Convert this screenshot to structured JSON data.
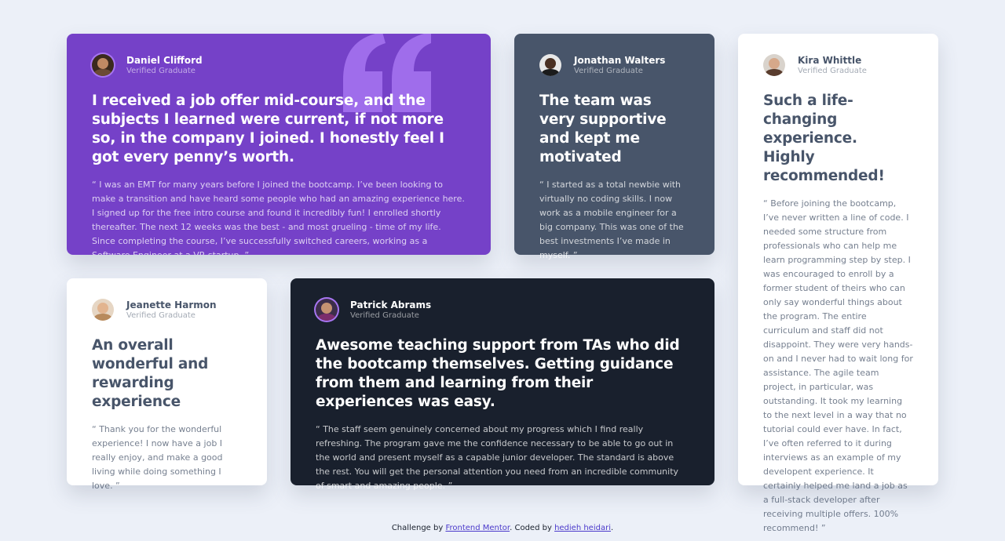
{
  "testimonials": [
    {
      "name": "Daniel Clifford",
      "role": "Verified Graduate",
      "headline": "I received a job offer mid-course, and the subjects I learned were current, if not more so, in the company I joined. I honestly feel I got every penny’s worth.",
      "body": "“ I was an EMT for many years before I joined the bootcamp. I’ve been looking to make a transition and have heard some people who had an amazing experience here. I signed up for the free intro course and found it incredibly fun! I enrolled shortly thereafter. The next 12 weeks was the best - and most grueling - time of my life. Since completing the course, I’ve successfully switched careers, working as a Software Engineer at a VR startup. ”",
      "bg": "#7541C8"
    },
    {
      "name": "Jonathan Walters",
      "role": "Verified Graduate",
      "headline": "The team was very supportive and kept me motivated",
      "body": "“ I started as a total newbie with virtually no coding skills. I now work as a mobile engineer for a big company. This was one of the best investments I’ve made in myself. ”",
      "bg": "#48556A"
    },
    {
      "name": "Kira Whittle",
      "role": "Verified Graduate",
      "headline": "Such a life-changing experience. Highly recommended!",
      "body": "“ Before joining the bootcamp, I’ve never written a line of code. I needed some structure from professionals who can help me learn programming step by step. I was encouraged to enroll by a former student of theirs who can only say wonderful things about the program. The entire curriculum and staff did not disappoint. They were very hands-on and I never had to wait long for assistance. The agile team project, in particular, was outstanding. It took my learning to the next level in a way that no tutorial could ever have. In fact, I’ve often referred to it during interviews as an example of my developent experience. It certainly helped me land a job as a full-stack developer after receiving multiple offers. 100% recommend! ”",
      "bg": "#FFFFFF"
    },
    {
      "name": "Jeanette Harmon",
      "role": "Verified Graduate",
      "headline": "An overall wonderful and rewarding experience",
      "body": "“ Thank you for the wonderful experience! I now have a job I really enjoy, and make a good living while doing something I love. ”",
      "bg": "#FFFFFF"
    },
    {
      "name": "Patrick Abrams",
      "role": "Verified Graduate",
      "headline": "Awesome teaching support from TAs who did the bootcamp themselves. Getting guidance from them and learning from their experiences was easy.",
      "body": "“ The staff seem genuinely concerned about my progress which I find really refreshing. The program gave me the confidence necessary to be able to go out in the world and present myself as a capable junior developer. The standard is above the rest. You will get the personal attention you need from an incredible community of smart and amazing people. ”",
      "bg": "#19202D"
    }
  ],
  "footer": {
    "prefix": "Challenge by ",
    "link1": "Frontend Mentor",
    "middle": ". Coded by ",
    "link2": "hedieh heidari",
    "suffix": "."
  },
  "colors": {
    "page_bg": "#ECF0F8",
    "accent_purple": "#7541C8",
    "quote_mark": "#A775F1"
  },
  "icons": {
    "quote": "quotation-mark-icon"
  }
}
